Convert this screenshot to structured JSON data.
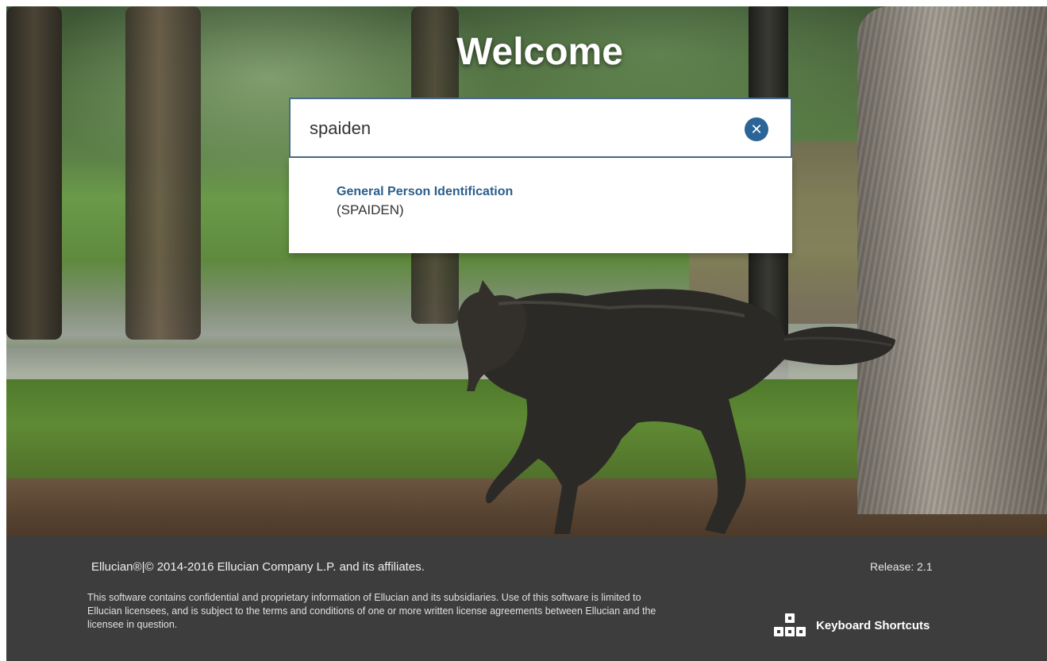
{
  "hero": {
    "welcome_text": "Welcome"
  },
  "search": {
    "value": "spaiden",
    "clear_icon": "clear-circle-icon"
  },
  "results": [
    {
      "title": "General Person Identification",
      "code": "(SPAIDEN)"
    }
  ],
  "footer": {
    "copyright": "Ellucian®|© 2014-2016 Ellucian Company L.P. and its affiliates.",
    "disclaimer": "This software contains confidential and proprietary information of Ellucian and its subsidiaries. Use of this software is limited to Ellucian licensees, and is subject to the terms and conditions of one or more written license agreements between Ellucian and the licensee in question.",
    "release": "Release: 2.1",
    "keyboard_shortcuts_label": "Keyboard Shortcuts",
    "keyboard_icon": "keyboard-keys-icon"
  },
  "colors": {
    "accent": "#2b6496",
    "result_title": "#2b5e8c",
    "footer_bg": "#3d3d3d"
  }
}
